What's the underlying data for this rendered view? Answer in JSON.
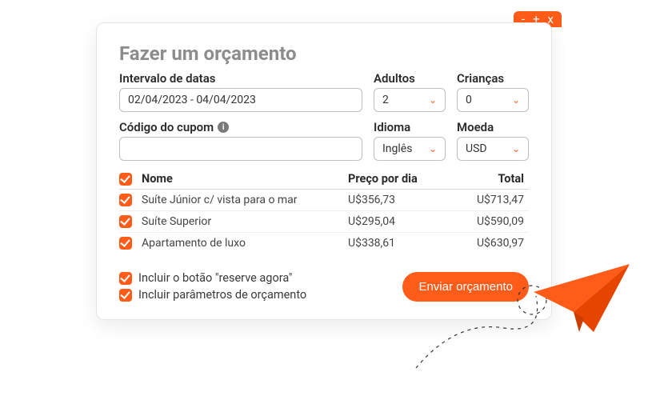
{
  "titlebar": {
    "min": "-",
    "max": "+",
    "close": "x"
  },
  "header": {
    "title": "Fazer um orçamento"
  },
  "fields": {
    "dateLabel": "Intervalo de datas",
    "dateValue": "02/04/2023 - 04/04/2023",
    "adultsLabel": "Adultos",
    "adultsValue": "2",
    "childrenLabel": "Crianças",
    "childrenValue": "0",
    "couponLabel": "Código do cupom",
    "couponValue": "",
    "languageLabel": "Idioma",
    "languageValue": "Inglês",
    "currencyLabel": "Moeda",
    "currencyValue": "USD"
  },
  "table": {
    "colName": "Nome",
    "colPrice": "Preço por dia",
    "colTotal": "Total",
    "rows": [
      {
        "name": "Suíte Júnior c/ vista para o mar",
        "price": "U$356,73",
        "total": "U$713,47"
      },
      {
        "name": "Suíte Superior",
        "price": "U$295,04",
        "total": "U$590,09"
      },
      {
        "name": "Apartamento de luxo",
        "price": "U$338,61",
        "total": "U$630,97"
      }
    ]
  },
  "options": {
    "includeBookNow": "Incluir o botão \"reserve agora\"",
    "includeParams": "Incluir parâmetros de orçamento"
  },
  "actions": {
    "send": "Enviar orçamento"
  },
  "colors": {
    "accent": "#ff5c1a"
  }
}
